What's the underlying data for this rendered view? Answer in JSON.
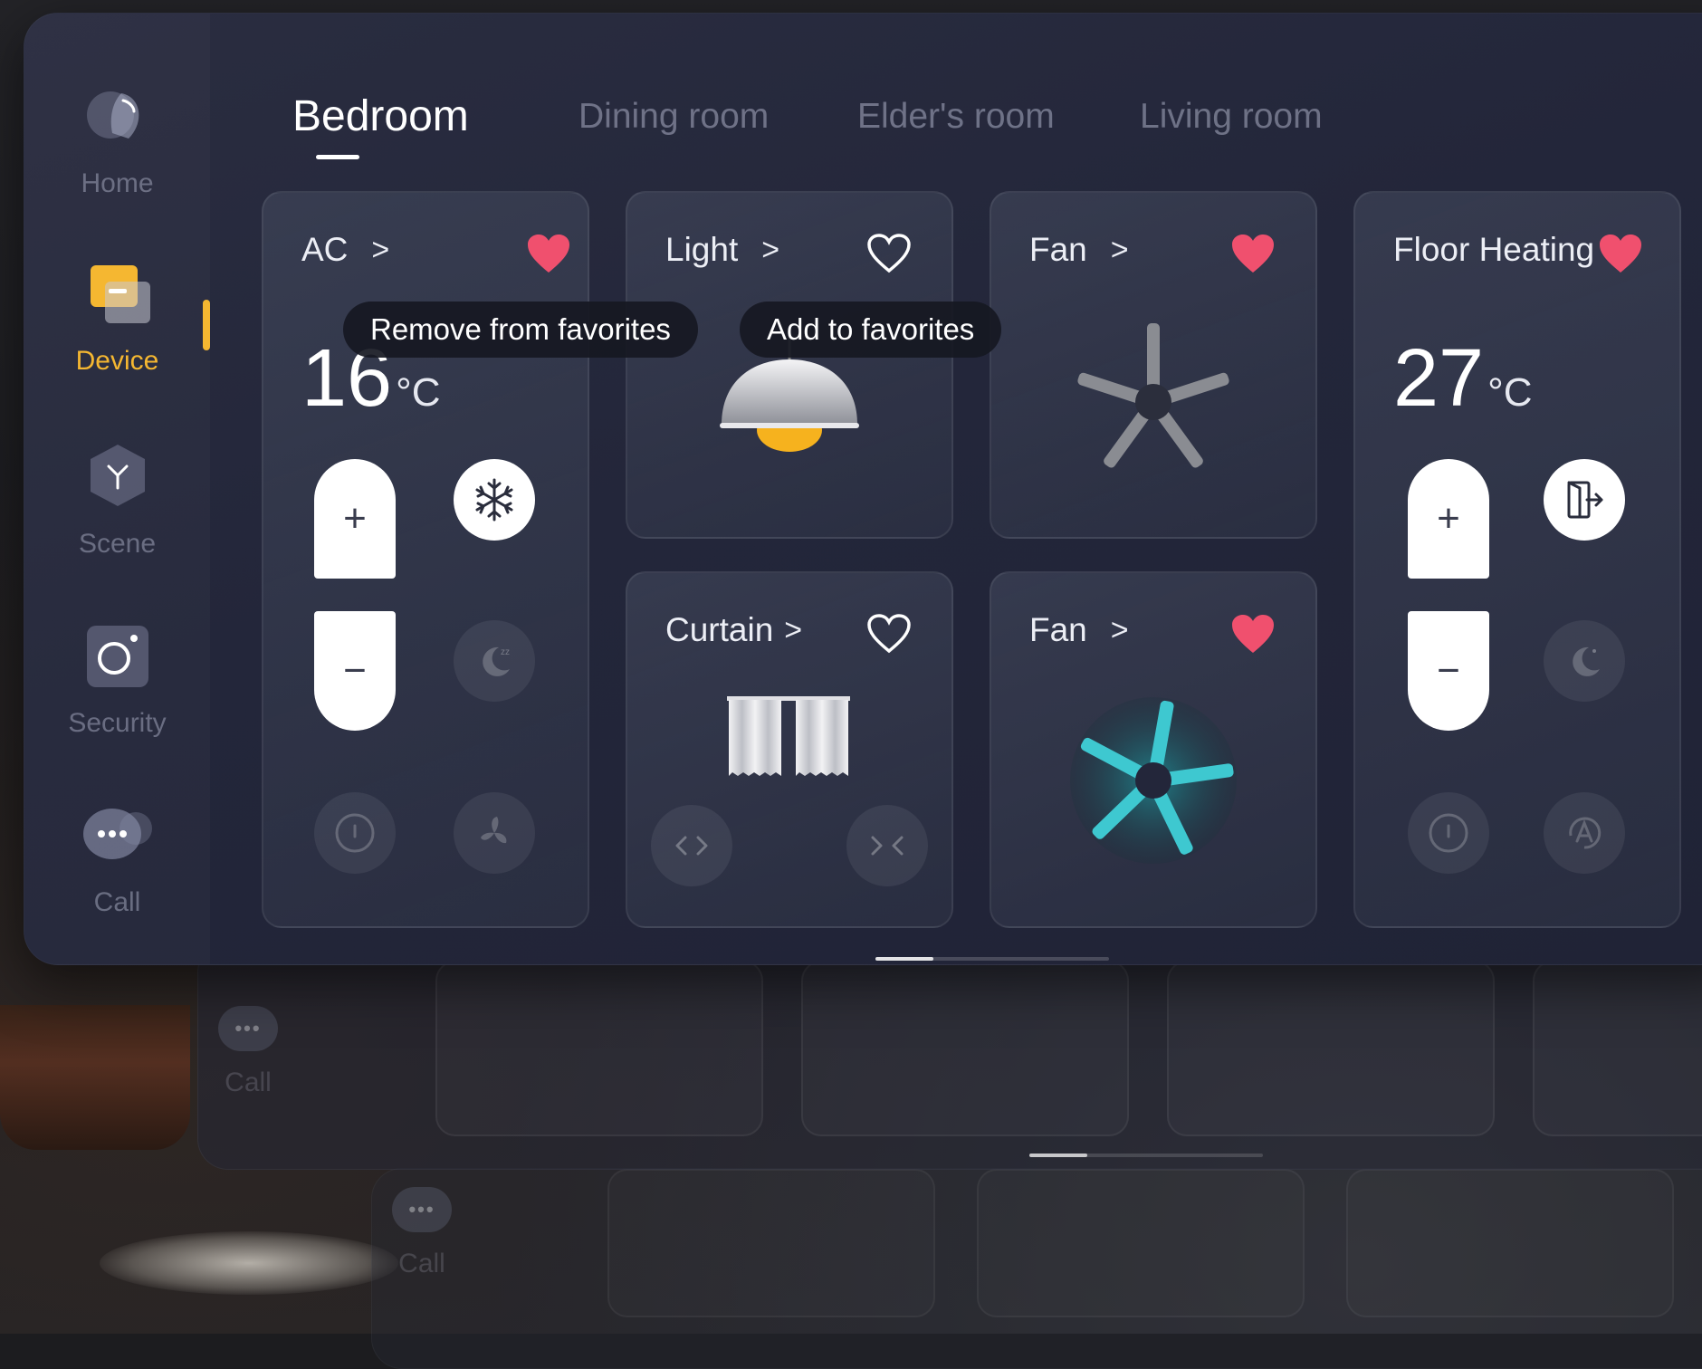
{
  "nav": {
    "items": [
      {
        "label": "Home",
        "icon": "home-icon"
      },
      {
        "label": "Device",
        "icon": "device-icon",
        "active": true
      },
      {
        "label": "Scene",
        "icon": "scene-icon"
      },
      {
        "label": "Security",
        "icon": "security-camera-icon"
      },
      {
        "label": "Call",
        "icon": "chat-bubble-icon"
      }
    ]
  },
  "tabs": [
    {
      "label": "Bedroom",
      "active": true
    },
    {
      "label": "Dining room"
    },
    {
      "label": "Elder's room"
    },
    {
      "label": "Living room"
    }
  ],
  "cards": {
    "ac": {
      "title": "AC",
      "chevron": ">",
      "favorite": true,
      "temp_value": "16",
      "temp_unit": "°C",
      "plus": "+",
      "minus": "−",
      "mode_icon": "snowflake-icon",
      "sleep_icon": "sleep-moon-icon",
      "power_icon": "power-icon",
      "fan_icon": "fan-speed-icon"
    },
    "light": {
      "title": "Light",
      "chevron": ">",
      "favorite": false,
      "icon": "pendant-lamp-icon"
    },
    "fan1": {
      "title": "Fan",
      "chevron": ">",
      "favorite": true,
      "icon": "ceiling-fan-icon",
      "state": "off"
    },
    "floor_heating": {
      "title": "Floor Heating",
      "favorite": true,
      "temp_value": "27",
      "temp_unit": "°C",
      "plus": "+",
      "minus": "−",
      "mode_icon": "exit-door-icon",
      "sleep_icon": "night-moon-icon",
      "power_icon": "power-icon",
      "auto_icon": "auto-mode-icon"
    },
    "curtain": {
      "title": "Curtain",
      "chevron": ">",
      "favorite": false,
      "icon": "curtain-icon",
      "open_icon": "curtain-open-icon",
      "close_icon": "curtain-close-icon"
    },
    "fan2": {
      "title": "Fan",
      "chevron": ">",
      "favorite": true,
      "icon": "spinning-fan-icon",
      "state": "on"
    }
  },
  "tooltips": {
    "remove": "Remove from favorites",
    "add": "Add to favorites"
  },
  "back_panels": {
    "call_label": "Call"
  },
  "colors": {
    "accent": "#f5b731",
    "heart": "#f0506e",
    "fan_active": "#3ec8d0",
    "panel": "#23263a"
  },
  "page_indicator": {
    "current": 1,
    "total": 4
  }
}
